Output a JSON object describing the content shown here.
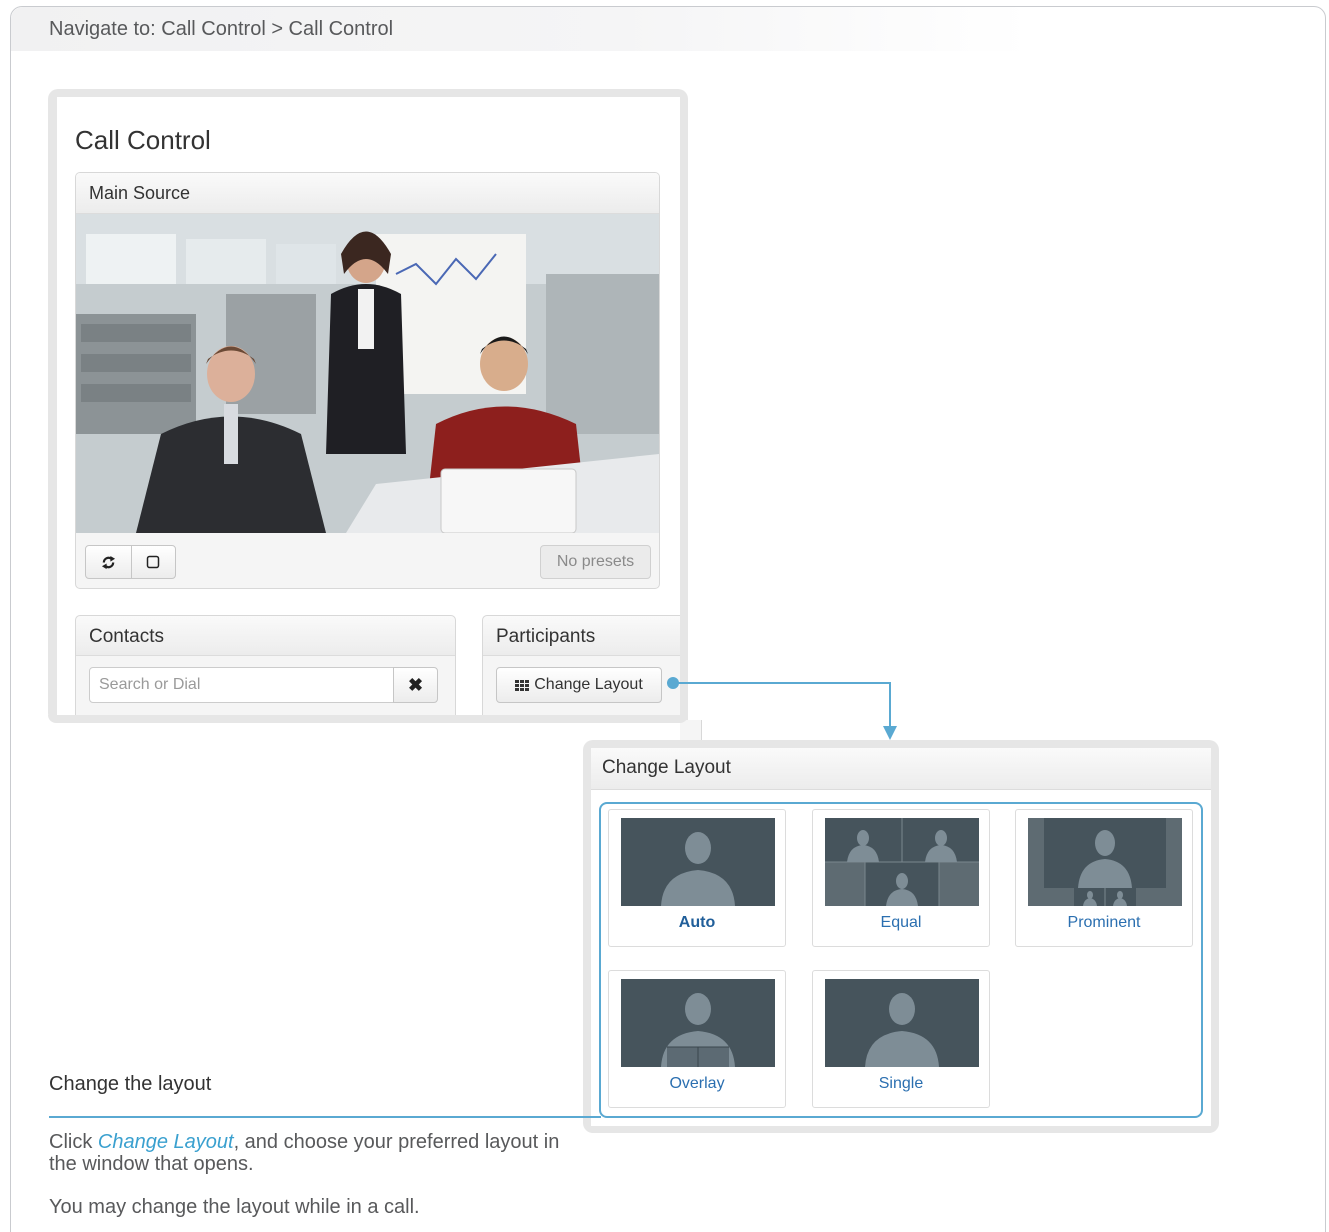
{
  "breadcrumb": {
    "text": "Navigate to: Call Control > Call Control"
  },
  "call_control": {
    "title": "Call Control",
    "main_source": {
      "header": "Main Source",
      "refresh_icon": "refresh-icon",
      "fullscreen_icon": "square-icon",
      "presets_label": "No presets"
    },
    "contacts": {
      "header": "Contacts",
      "search_placeholder": "Search or Dial",
      "clear_icon": "close-icon"
    },
    "participants": {
      "header": "Participants",
      "change_layout_label": "Change Layout",
      "change_layout_icon": "grid-icon"
    }
  },
  "change_layout_dialog": {
    "header": "Change Layout",
    "options": [
      {
        "label": "Auto",
        "selected": true
      },
      {
        "label": "Equal",
        "selected": false
      },
      {
        "label": "Prominent",
        "selected": false
      },
      {
        "label": "Overlay",
        "selected": false
      },
      {
        "label": "Single",
        "selected": false
      }
    ]
  },
  "instructions": {
    "title": "Change the layout",
    "para1_prefix": "Click ",
    "para1_link": "Change Layout",
    "para1_suffix": ", and choose your preferred layout in the window that opens.",
    "para2": "You may change the layout while in a call."
  },
  "colors": {
    "accent": "#5aa9d2",
    "link_blue": "#2b6fb0",
    "thumb_bg": "#46545c"
  }
}
